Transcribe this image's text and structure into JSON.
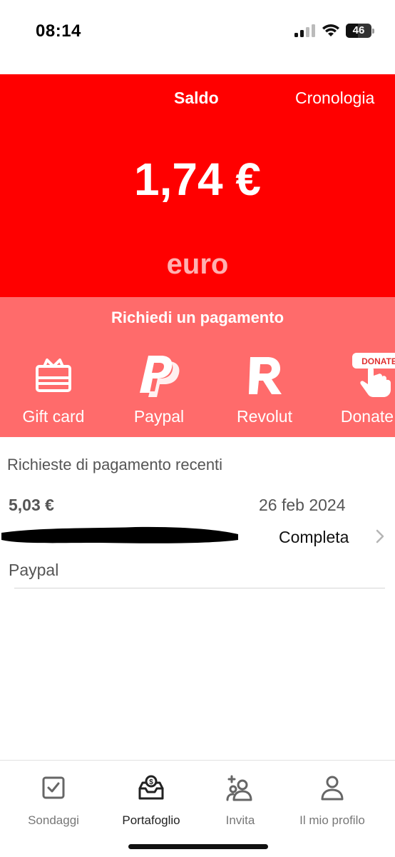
{
  "status_bar": {
    "time": "08:14",
    "battery": "46",
    "battery_level": 0.46
  },
  "header": {
    "tabs": [
      {
        "label": "Saldo",
        "active": true
      },
      {
        "label": "Cronologia",
        "active": false
      }
    ]
  },
  "balance": {
    "amount": "1,74 €",
    "currency": "euro"
  },
  "request": {
    "title": "Richiedi un pagamento",
    "methods": [
      {
        "label": "Gift card",
        "icon": "gift-card-icon"
      },
      {
        "label": "Paypal",
        "icon": "paypal-icon"
      },
      {
        "label": "Revolut",
        "icon": "revolut-icon"
      },
      {
        "label": "Donate",
        "icon": "donate-icon",
        "badge": "DONATE"
      }
    ]
  },
  "recent": {
    "title": "Richieste di pagamento recenti",
    "items": [
      {
        "amount": "5,03 €",
        "date": "26 feb 2024",
        "status": "Completa",
        "method": "Paypal"
      }
    ]
  },
  "bottom_nav": {
    "items": [
      {
        "label": "Sondaggi",
        "icon": "checkbox-icon",
        "active": false
      },
      {
        "label": "Portafoglio",
        "icon": "wallet-icon",
        "active": true
      },
      {
        "label": "Invita",
        "icon": "invite-users-icon",
        "active": false
      },
      {
        "label": "Il mio profilo",
        "icon": "user-icon",
        "active": false
      }
    ]
  },
  "colors": {
    "primary_red": "#ff0000",
    "light_red": "#ff6b6b",
    "currency_tint": "#ffb0b0"
  }
}
